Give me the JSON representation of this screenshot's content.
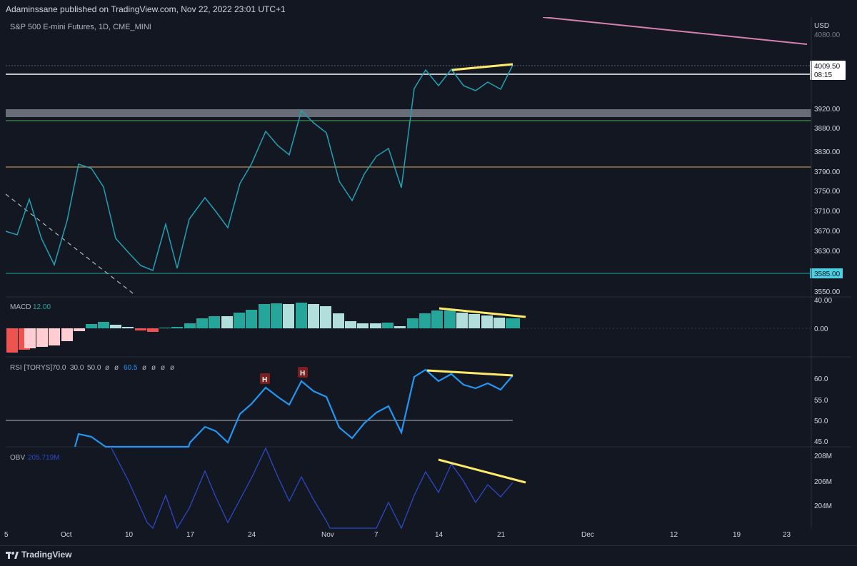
{
  "header": {
    "publisher": "Adaminssane published on TradingView.com, Nov 22, 2022 23:01 UTC+1"
  },
  "main_pane": {
    "symbol_title": "S&P 500 E-mini Futures, 1D, CME_MINI",
    "currency": "USD",
    "price_labels": [
      "4080.00",
      "3920.00",
      "3880.00",
      "3830.00",
      "3790.00",
      "3750.00",
      "3710.00",
      "3670.00",
      "3630.00",
      "3550.00"
    ],
    "last_price": "4009.50",
    "countdown": "08:15",
    "support_level": "3585.00"
  },
  "macd_pane": {
    "label": "MACD",
    "value": "12.00",
    "axis_labels": [
      "40.00",
      "0.00"
    ]
  },
  "rsi_pane": {
    "label": "RSI [TORYS]",
    "params": [
      "70.0",
      "30.0",
      "50.0",
      "ø",
      "ø"
    ],
    "value": "60.5",
    "params_tail": [
      "ø",
      "ø",
      "ø",
      "ø"
    ],
    "axis_labels": [
      "60.0",
      "55.0",
      "50.0",
      "45.0"
    ],
    "markers": [
      "H",
      "H"
    ]
  },
  "obv_pane": {
    "label": "OBV",
    "value": "205.719M",
    "axis_labels": [
      "208M",
      "206M",
      "204M"
    ]
  },
  "time_axis": {
    "labels": [
      "5",
      "Oct",
      "10",
      "17",
      "24",
      "Nov",
      "7",
      "14",
      "21",
      "Dec",
      "12",
      "19",
      "23"
    ]
  },
  "footer": {
    "brand": "TradingView"
  },
  "colors": {
    "background": "#131722",
    "price_line": "#1fa2b4",
    "annotation": "#ffeb6b",
    "rsi_line": "#2196f3",
    "obv_line": "#2c48c4",
    "macd_up_strong": "#26a69a",
    "macd_up_weak": "#b2dfdb",
    "macd_down_strong": "#ef5350",
    "macd_down_weak": "#ffcdd2",
    "resistance_zone": "#787b86",
    "green_line": "#4caf50",
    "orange_line": "#e0a85b",
    "pink_trend": "#d781b3"
  }
}
